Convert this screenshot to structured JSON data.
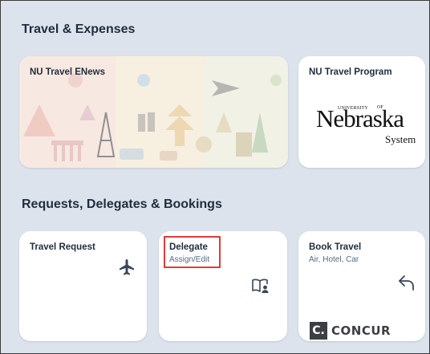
{
  "sections": {
    "travel_expenses": {
      "title": "Travel & Expenses"
    },
    "requests": {
      "title": "Requests, Delegates & Bookings"
    }
  },
  "tiles": {
    "enews": {
      "title": "NU Travel ENews",
      "art": "travel-landmarks-collage"
    },
    "program": {
      "title": "NU Travel Program",
      "logo": {
        "word": "Nebraska",
        "university": "UNIVERSITY",
        "of": "OF",
        "system": "System"
      }
    },
    "travel_request": {
      "title": "Travel Request",
      "icon": "airplane-icon"
    },
    "delegate": {
      "title": "Delegate",
      "subtitle": "Assign/Edit",
      "icon": "book-person-icon"
    },
    "book_travel": {
      "title": "Book Travel",
      "subtitle": "Air, Hotel, Car",
      "icon": "back-arrow-icon",
      "logo": {
        "letter": "C.",
        "word": "CONCUR"
      }
    }
  },
  "colors": {
    "background": "#dce3ec",
    "card": "#ffffff",
    "text": "#1f2d3d",
    "highlight": "#e23b3b",
    "concur": "#3b3f45"
  }
}
